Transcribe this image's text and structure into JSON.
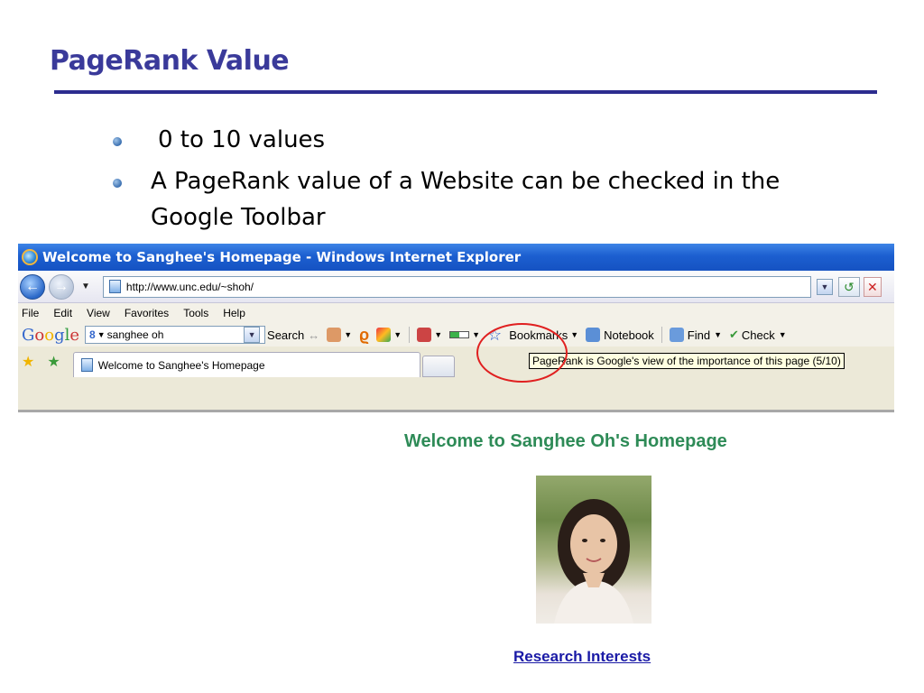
{
  "slide": {
    "title": "PageRank Value",
    "bullets": [
      "0 to 10 values",
      "A PageRank value of a Website can be checked in the Google Toolbar"
    ]
  },
  "browser": {
    "window_title": "Welcome to Sanghee's Homepage - Windows Internet Explorer",
    "url": "http://www.unc.edu/~shoh/",
    "menu": [
      "File",
      "Edit",
      "View",
      "Favorites",
      "Tools",
      "Help"
    ],
    "google_toolbar": {
      "logo": "Google",
      "search_value": "sanghee oh",
      "search_button": "Search",
      "pagerank_value": 0.5,
      "bookmarks": "Bookmarks",
      "notebook": "Notebook",
      "find": "Find",
      "check": "Check"
    },
    "tab_title": "Welcome to Sanghee's Homepage",
    "tooltip": "PageRank is Google's view of the importance of this page (5/10)"
  },
  "homepage": {
    "heading": "Welcome to Sanghee Oh's Homepage",
    "link": "Research Interests"
  },
  "colors": {
    "title": "#3a3a9a",
    "rule": "#2c2c8f",
    "heading_green": "#2e8b57",
    "link_blue": "#1a1aa6",
    "highlight_circle": "#e02020"
  }
}
